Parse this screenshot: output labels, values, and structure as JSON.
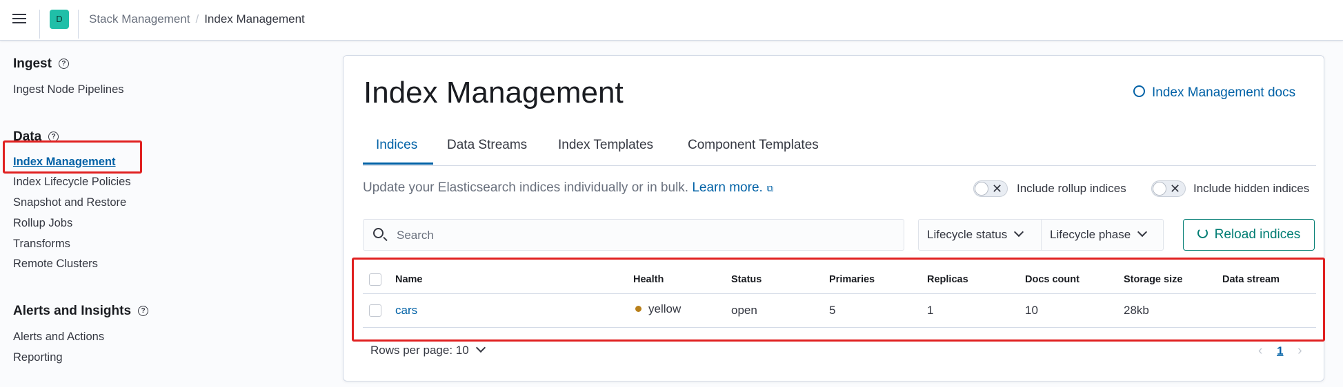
{
  "header": {
    "space_initial": "D",
    "breadcrumbs": [
      "Stack Management",
      "Index Management"
    ]
  },
  "sidebar": {
    "sections": [
      {
        "title": "Ingest",
        "items": [
          "Ingest Node Pipelines"
        ]
      },
      {
        "title": "Data",
        "items": [
          "Index Management",
          "Index Lifecycle Policies",
          "Snapshot and Restore",
          "Rollup Jobs",
          "Transforms",
          "Remote Clusters"
        ]
      },
      {
        "title": "Alerts and Insights",
        "items": [
          "Alerts and Actions",
          "Reporting"
        ]
      }
    ],
    "active_item": "Index Management"
  },
  "main": {
    "title": "Index Management",
    "docs_link": "Index Management docs",
    "tabs": [
      "Indices",
      "Data Streams",
      "Index Templates",
      "Component Templates"
    ],
    "active_tab": "Indices",
    "description": "Update your Elasticsearch indices individually or in bulk.",
    "learn_more": "Learn more.",
    "toggles": [
      {
        "label": "Include rollup indices",
        "on": false
      },
      {
        "label": "Include hidden indices",
        "on": false
      }
    ],
    "search_placeholder": "Search",
    "filters": [
      "Lifecycle status",
      "Lifecycle phase"
    ],
    "reload_label": "Reload indices",
    "table": {
      "columns": [
        "Name",
        "Health",
        "Status",
        "Primaries",
        "Replicas",
        "Docs count",
        "Storage size",
        "Data stream"
      ],
      "rows": [
        {
          "name": "cars",
          "health": "yellow",
          "status": "open",
          "primaries": "5",
          "replicas": "1",
          "docs_count": "10",
          "storage_size": "28kb",
          "data_stream": ""
        }
      ]
    },
    "rows_per_page": "Rows per page: 10",
    "current_page": "1"
  },
  "colors": {
    "accent": "#0061a6",
    "reload": "#017d73",
    "health_yellow": "#b9801a",
    "highlight": "#e02020"
  }
}
